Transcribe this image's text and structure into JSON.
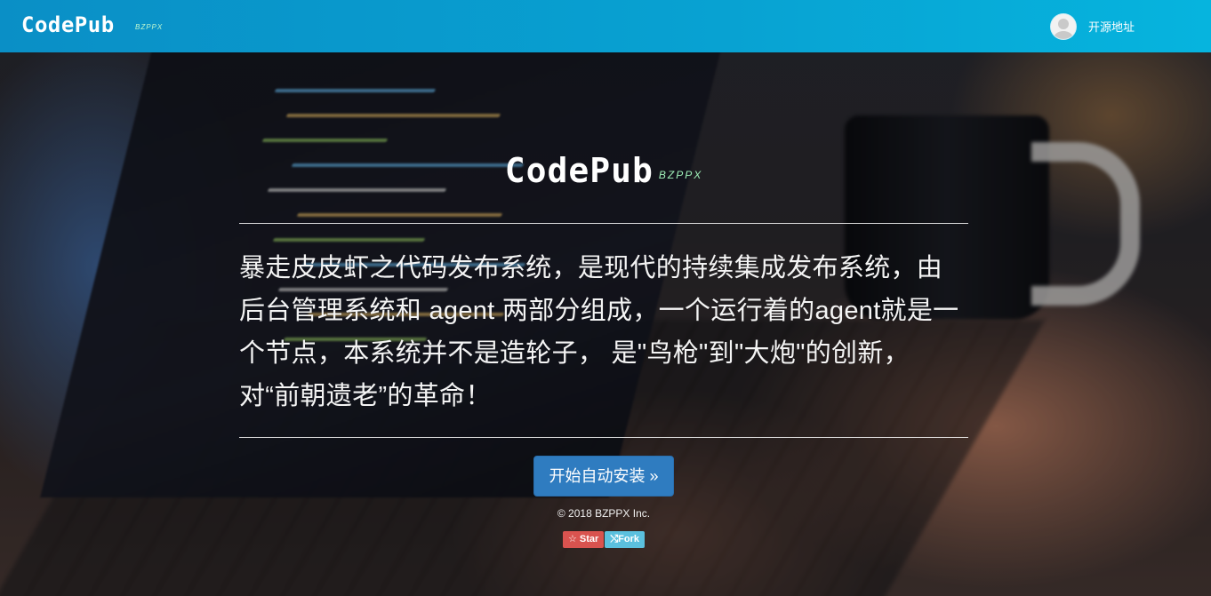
{
  "navbar": {
    "brand": "CodePub",
    "brand_sub": "BZPPX",
    "link_label": "开源地址"
  },
  "hero": {
    "logo": "CodePub",
    "logo_sub": "BZPPX",
    "description": "暴走皮皮虾之代码发布系统，是现代的持续集成发布系统，由后台管理系统和 agent 两部分组成，一个运行着的agent就是一个节点，本系统并不是造轮子， 是\"鸟枪\"到\"大炮\"的创新，对“前朝遗老”的革命！",
    "cta_label": "开始自动安装 »",
    "copyright": "© 2018 BZPPX Inc.",
    "star_label": "☆ Star",
    "fork_label": "⤭Fork"
  },
  "colors": {
    "navbar_start": "#0a8fc6",
    "navbar_end": "#06b4de",
    "cta": "#2f7cc0",
    "star_badge": "#d9534f",
    "fork_badge": "#5bc0de",
    "logo_sub": "#9ff0b8"
  },
  "icons": {
    "avatar": "user-avatar-icon",
    "star": "star-icon",
    "fork": "fork-icon"
  }
}
